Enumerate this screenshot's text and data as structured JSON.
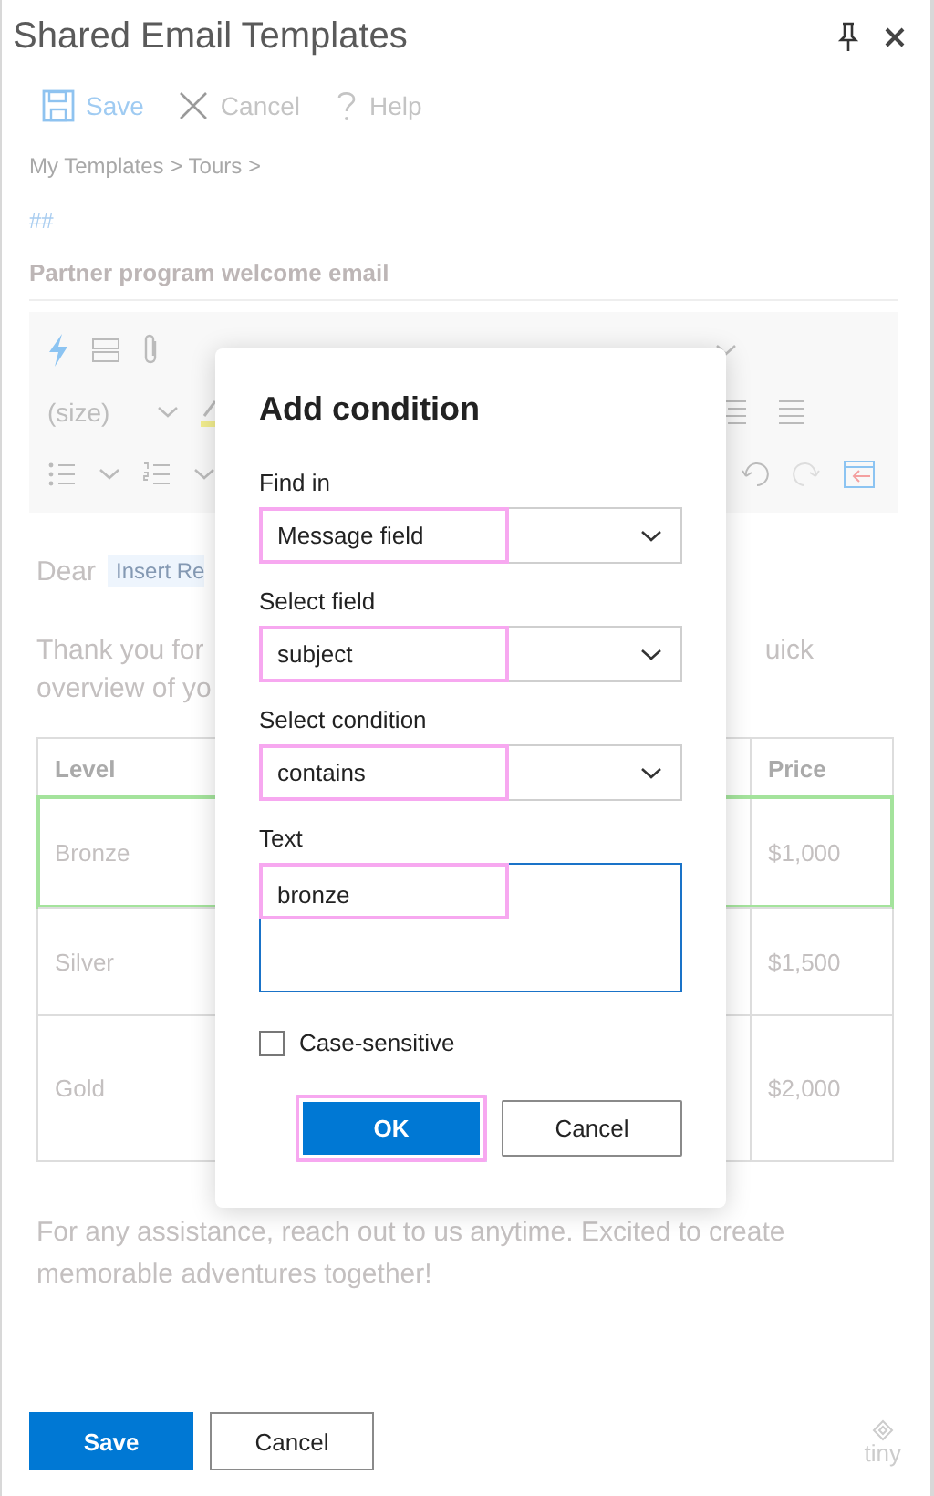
{
  "window": {
    "title": "Shared Email Templates"
  },
  "commands": [
    {
      "kind": "save",
      "label": "Save"
    },
    {
      "kind": "cancel",
      "label": "Cancel"
    },
    {
      "kind": "help",
      "label": "Help"
    }
  ],
  "breadcrumb": "My Templates > Tours >",
  "hash_mark": "##",
  "template_name": "Partner program welcome email",
  "editor_toolbar": {
    "size_label": "(size)"
  },
  "body": {
    "greeting": "Dear",
    "macro_tag": "Insert Re",
    "intro_left": "Thank you for",
    "intro_right": "uick",
    "intro_line_2": "overview of yo"
  },
  "table": {
    "columns": [
      "Level",
      "Price"
    ],
    "rows": [
      {
        "cells": [
          "Bronze",
          "$1,000"
        ],
        "highlighted": true
      },
      {
        "cells": [
          "Silver",
          "$1,500"
        ],
        "highlighted": false
      },
      {
        "cells": [
          "Gold",
          "$2,000"
        ],
        "highlighted": false
      }
    ]
  },
  "closing": "For any assistance, reach out to us anytime. Excited to create memorable adventures together!",
  "dialog": {
    "title": "Add condition",
    "fields": [
      {
        "kind": "dropdown",
        "label": "Find in",
        "value": "Message field",
        "highlighted": true
      },
      {
        "kind": "dropdown",
        "label": "Select field",
        "value": "subject",
        "highlighted": true
      },
      {
        "kind": "dropdown",
        "label": "Select condition",
        "value": "contains",
        "highlighted": true
      },
      {
        "kind": "textarea",
        "label": "Text",
        "value": "bronze",
        "highlighted": true
      }
    ],
    "checkbox": {
      "label": "Case-sensitive",
      "checked": false
    },
    "buttons": [
      {
        "label": "OK",
        "primary": true,
        "highlighted": true
      },
      {
        "label": "Cancel",
        "primary": false,
        "highlighted": false
      }
    ]
  },
  "footer_buttons": [
    {
      "label": "Save",
      "primary": true
    },
    {
      "label": "Cancel",
      "primary": false
    }
  ],
  "brand": "tiny"
}
